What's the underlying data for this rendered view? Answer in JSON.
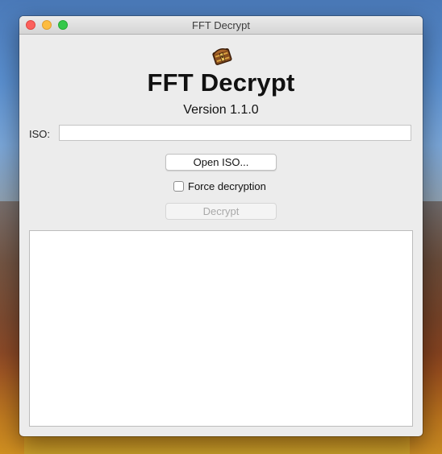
{
  "window": {
    "title": "FFT Decrypt"
  },
  "app": {
    "icon": "treasure-chest-icon",
    "name": "FFT Decrypt",
    "version": "Version 1.1.0"
  },
  "iso": {
    "label": "ISO:",
    "value": "",
    "placeholder": ""
  },
  "buttons": {
    "open_label": "Open ISO...",
    "decrypt_label": "Decrypt"
  },
  "force": {
    "label": "Force decryption",
    "checked": false
  },
  "log": {
    "text": ""
  },
  "colors": {
    "window_bg": "#ececec",
    "close": "#fc615d",
    "minimize": "#fdbc40",
    "maximize": "#34c84a",
    "disabled_text": "#a9a9a9"
  }
}
